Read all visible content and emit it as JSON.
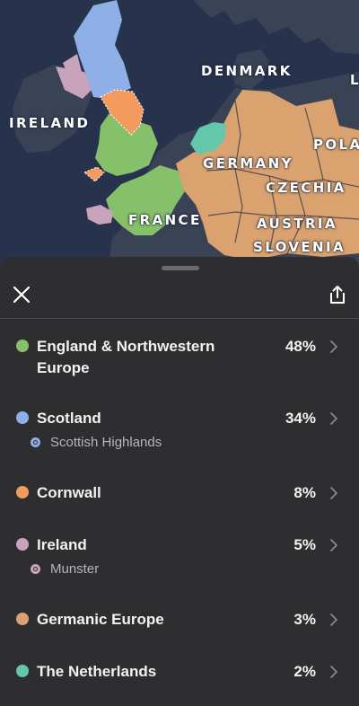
{
  "map": {
    "labels": {
      "denmark": "DENMARK",
      "ireland": "IRELAND",
      "germany": "GERMANY",
      "pola": "POLA",
      "czechia": "CZECHIA",
      "france": "FRANCE",
      "austria": "AUSTRIA",
      "slovenia": "SLOVENIA",
      "edge_l": "L"
    },
    "colors": {
      "sea": "#27334d",
      "land": "#3a4256",
      "england": "#86c06a",
      "scotland": "#8fb0e6",
      "cornwall": "#f39b5e",
      "ireland": "#c9a3bc",
      "germanic": "#d9a26f",
      "netherlands": "#64c7aa"
    }
  },
  "sheet": {
    "close_icon": "close-icon",
    "share_icon": "share-icon"
  },
  "ethnicities": [
    {
      "name": "England & Northwestern Europe",
      "percent": "48%",
      "color": "#86c06a"
    },
    {
      "name": "Scotland",
      "percent": "34%",
      "color": "#8fb0e6",
      "sub": "Scottish Highlands"
    },
    {
      "name": "Cornwall",
      "percent": "8%",
      "color": "#f39b5e"
    },
    {
      "name": "Ireland",
      "percent": "5%",
      "color": "#c9a3bc",
      "sub": "Munster"
    },
    {
      "name": "Germanic Europe",
      "percent": "3%",
      "color": "#d9a26f"
    },
    {
      "name": "The Netherlands",
      "percent": "2%",
      "color": "#64c7aa"
    }
  ]
}
